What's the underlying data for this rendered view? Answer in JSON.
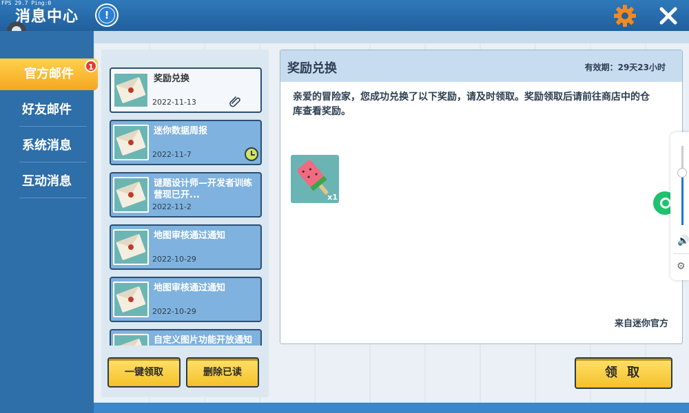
{
  "header": {
    "fps_text": "FPS 29.7  Ping:0",
    "title": "消息中心"
  },
  "sidebar": {
    "items": [
      {
        "label": "官方邮件",
        "active": true,
        "badge": "1"
      },
      {
        "label": "好友邮件",
        "active": false
      },
      {
        "label": "系统消息",
        "active": false
      },
      {
        "label": "互动消息",
        "active": false
      }
    ]
  },
  "mail_list": [
    {
      "title": "奖励兑换",
      "date": "2022-11-13",
      "selected": true,
      "icon": "paperclip-icon"
    },
    {
      "title": "迷你数据周报",
      "date": "2022-11-7",
      "selected": false,
      "icon": "clock-icon"
    },
    {
      "title": "谜题设计师—开发者训练营现已开...",
      "date": "2022-11-2",
      "selected": false
    },
    {
      "title": "地图审核通过通知",
      "date": "2022-10-29",
      "selected": false
    },
    {
      "title": "地图审核通过通知",
      "date": "2022-10-29",
      "selected": false
    },
    {
      "title": "自定义图片功能开放通知",
      "date": "",
      "selected": false
    }
  ],
  "buttons": {
    "claim_all": "一键领取",
    "delete_read": "删除已读",
    "claim": "领 取"
  },
  "detail": {
    "title": "奖励兑换",
    "expiry": "有效期：29天23小时",
    "body": "亲爱的冒险家，您成功兑换了以下奖励，请及时领取。奖励领取后请前往商店中的仓库查看奖励。",
    "reward_count": "x1",
    "from": "来自迷你官方"
  },
  "colors": {
    "accent_yellow": "#f5c12b",
    "header_blue": "#2f79ba",
    "badge_red": "#e53b30",
    "gear_orange": "#f08a24"
  }
}
